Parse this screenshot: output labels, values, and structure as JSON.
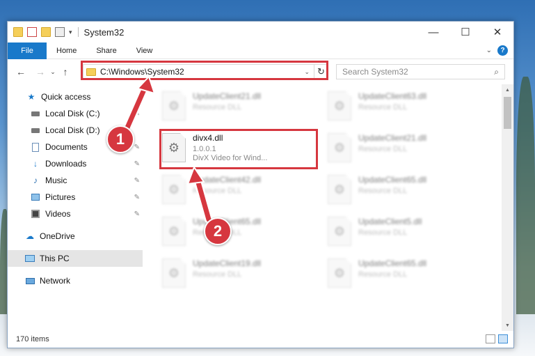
{
  "window": {
    "title": "System32",
    "controls": {
      "minimize": "—",
      "maximize": "☐",
      "close": "✕"
    }
  },
  "ribbon": {
    "tabs": [
      "File",
      "Home",
      "Share",
      "View"
    ],
    "help": "?"
  },
  "address": {
    "path": "C:\\Windows\\System32",
    "search_placeholder": "Search System32"
  },
  "sidebar": {
    "quick_access": "Quick access",
    "items": [
      {
        "label": "Local Disk (C:)",
        "icon": "drive-icon",
        "pinned": true
      },
      {
        "label": "Local Disk (D:)",
        "icon": "drive-icon",
        "pinned": false
      },
      {
        "label": "Documents",
        "icon": "documents-icon",
        "pinned": true
      },
      {
        "label": "Downloads",
        "icon": "downloads-icon",
        "pinned": true
      },
      {
        "label": "Music",
        "icon": "music-icon",
        "pinned": true
      },
      {
        "label": "Pictures",
        "icon": "pictures-icon",
        "pinned": true
      },
      {
        "label": "Videos",
        "icon": "videos-icon",
        "pinned": true
      }
    ],
    "onedrive": "OneDrive",
    "this_pc": "This PC",
    "network": "Network"
  },
  "files": {
    "left": [
      {
        "name": "UpdateClient21.dll",
        "type": "Resource DLL"
      },
      {
        "name": "divx4.dll",
        "version": "1.0.0.1",
        "desc": "DivX Video for Wind..."
      },
      {
        "name": "UpdateClient42.dll",
        "type": "Resource DLL"
      },
      {
        "name": "UpdateClient65.dll",
        "type": "Resource DLL"
      },
      {
        "name": "UpdateClient19.dll",
        "type": "Resource DLL"
      }
    ],
    "right": [
      {
        "name": "UpdateClient63.dll",
        "type": "Resource DLL"
      },
      {
        "name": "UpdateClient21.dll",
        "type": "Resource DLL"
      },
      {
        "name": "UpdateClient65.dll",
        "type": "Resource DLL"
      },
      {
        "name": "UpdateClient5.dll",
        "type": "Resource DLL"
      },
      {
        "name": "UpdateClient65.dll",
        "type": "Resource DLL"
      }
    ]
  },
  "status": {
    "count": "170 items"
  },
  "annotations": {
    "step1": "1",
    "step2": "2"
  },
  "colors": {
    "accent": "#1979ca",
    "highlight": "#d6373f"
  }
}
